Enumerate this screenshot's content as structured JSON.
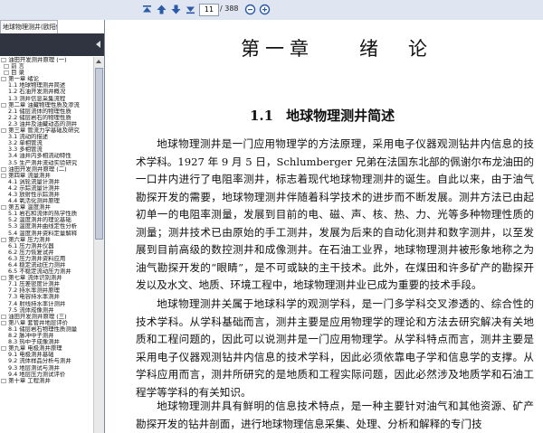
{
  "toolbar": {
    "page_current": "11",
    "page_total": "/ 388"
  },
  "sidebar": {
    "tab_title": "地球物理测井(欧阳健)员修...",
    "toc": [
      {
        "level": 0,
        "text": "□ 油田开发测井原理 (一)"
      },
      {
        "level": 1,
        "text": "□ 前  言"
      },
      {
        "level": 1,
        "text": "□ 目  录"
      },
      {
        "level": 0,
        "text": "□ 第一章  绪论"
      },
      {
        "level": 2,
        "text": "1.1  地球物理测井简述"
      },
      {
        "level": 2,
        "text": "1.2  石油开发测井概况"
      },
      {
        "level": 2,
        "text": "1.3  测井信息采集流程"
      },
      {
        "level": 0,
        "text": "□ 第二章  油藏物理性质及渗流"
      },
      {
        "level": 2,
        "text": "2.1  储层流体的物理性质"
      },
      {
        "level": 2,
        "text": "2.2  储层岩石的物理性质"
      },
      {
        "level": 2,
        "text": "2.3  油井及油藏动态的测井"
      },
      {
        "level": 0,
        "text": "□ 第三章  管流力学基础及研究"
      },
      {
        "level": 2,
        "text": "3.1  流动的描述"
      },
      {
        "level": 2,
        "text": "3.2  单相管流"
      },
      {
        "level": 2,
        "text": "3.3  多相管流"
      },
      {
        "level": 2,
        "text": "3.4  油井内多相流动特性"
      },
      {
        "level": 2,
        "text": "3.5  生产测井流动实验研究"
      },
      {
        "level": 0,
        "text": "□ 油田开发测井原理 (二)"
      },
      {
        "level": 0,
        "text": "□ 第四章  流量测井"
      },
      {
        "level": 2,
        "text": "4.1  涡轮流量计测井"
      },
      {
        "level": 2,
        "text": "4.2  示踪流量计测井"
      },
      {
        "level": 2,
        "text": "4.3  放射性示踪测井"
      },
      {
        "level": 2,
        "text": "4.4  氧活化测井原理"
      },
      {
        "level": 0,
        "text": "□ 第五章  温度测井"
      },
      {
        "level": 2,
        "text": "5.1  岩石和流体的热学性质"
      },
      {
        "level": 2,
        "text": "5.2  温度测井的理论基础"
      },
      {
        "level": 2,
        "text": "5.3  温度测井曲线定性分析"
      },
      {
        "level": 2,
        "text": "5.4  温度测井资料定量解释"
      },
      {
        "level": 0,
        "text": "□ 第六章  压力测井"
      },
      {
        "level": 2,
        "text": "6.1  压力测井仪器"
      },
      {
        "level": 2,
        "text": "6.2  压力恢复试井"
      },
      {
        "level": 2,
        "text": "6.3  压力测井资料应用"
      },
      {
        "level": 2,
        "text": "6.4  稳定流动压力测井"
      },
      {
        "level": 2,
        "text": "6.5  不稳定流动压力测井"
      },
      {
        "level": 0,
        "text": "□ 第七章  流体识别测井"
      },
      {
        "level": 2,
        "text": "7.1  压差密度计测井"
      },
      {
        "level": 2,
        "text": "7.2  持水率测井原理"
      },
      {
        "level": 2,
        "text": "7.3  电容持水率测井"
      },
      {
        "level": 2,
        "text": "7.4  射线持水率计测井"
      },
      {
        "level": 2,
        "text": "7.5  流体成像测井"
      },
      {
        "level": 0,
        "text": "□ 油田开发测井原理 (三)"
      },
      {
        "level": 0,
        "text": "□ 第八章  套管井地层评价"
      },
      {
        "level": 2,
        "text": "8.1  储层岩石物理性质测量"
      },
      {
        "level": 2,
        "text": "8.2  脉冲中子测井"
      },
      {
        "level": 2,
        "text": "8.3  热中子成像测井"
      },
      {
        "level": 0,
        "text": "□ 第九章  电极测井原理"
      },
      {
        "level": 2,
        "text": "9.1  电极测井基础"
      },
      {
        "level": 2,
        "text": "9.2  流体样品分析与测井"
      },
      {
        "level": 2,
        "text": "9.3  地层测试与测井"
      },
      {
        "level": 2,
        "text": "9.4  地层压力测试评价"
      },
      {
        "level": 0,
        "text": "□ 第十章  工程测井"
      }
    ]
  },
  "document": {
    "chapter_left": "第一章",
    "chapter_right": "绪　论",
    "section_number": "1.1",
    "section_title": "地球物理测井简述",
    "paragraphs": [
      "地球物理测井是一门应用物理学的方法原理，采用电子仪器观测钻井内信息的技术学科。1927 年 9 月 5 日，Schlumberger 兄弟在法国东北部的佩谢尔布龙油田的一口井内进行了电阻率测井，标志着现代地球物理测井的诞生。自此以来，由于油气勘探开发的需要，地球物理测井伴随着科学技术的进步而不断发展。测井方法已由起初单一的电阻率测量，发展到目前的电、磁、声、核、热、力、光等多种物理性质的测量；测井技术已由原始的手工测井，发展为后来的自动化测井和数字测井，以至发展到目前高级的数控测井和成像测井。在石油工业界，地球物理测井被形象地称之为油气勘探开发的“眼睛”，是不可或缺的主干技术。此外，在煤田和许多矿产的勘探开发以及水文、地质、环境工程中，地球物理测井业已成为重要的技术手段。",
      "地球物理测井关属于地球科学的观测学科，是一门多学科交叉渗透的、综合性的技术学科。从学科基础而言，测井主要是应用物理学的理论和方法去研究解决有关地质和工程问题的，因此可以说测井是一门应用物理学。从学科特点而言，测井主要是采用电子仪器观测钻井内信息的技术学科，因此必须依靠电子学和信息学的支撑。从学科应用而言，测井所研究的是地质和工程实际问题，因此必然涉及地质学和石油工程学等学科的有关知识。",
      "地球物理测井具有鲜明的信息技术特点，是一种主要针对油气和其他资源、矿产勘探开发的钻井剖面，进行地球物理信息采集、处理、分析和解释的专门技"
    ]
  }
}
